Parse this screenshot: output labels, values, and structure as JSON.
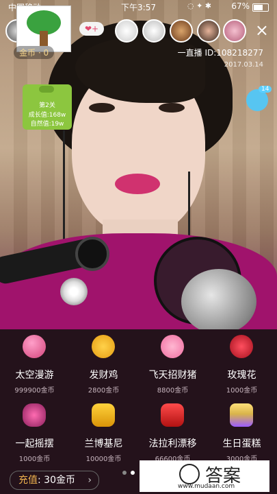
{
  "status_bar": {
    "carrier": "中国移动",
    "time": "下午3:57",
    "battery": "67%"
  },
  "header": {
    "coin_label": "金币 · 0",
    "follow_label": "❤+",
    "close_icon": "×",
    "live_id": "一直播 ID:108218277",
    "date": "2017.03.14"
  },
  "level_card": {
    "level": "第2关",
    "growth": "成长值:168w",
    "nature": "自然值:19w"
  },
  "water_badge": "14",
  "gifts": [
    {
      "name": "太空漫游",
      "price": "999900金币",
      "icon": "planet-icon"
    },
    {
      "name": "发财鸡",
      "price": "2800金币",
      "icon": "chicken-icon"
    },
    {
      "name": "飞天招财猪",
      "price": "8800金币",
      "icon": "pig-icon"
    },
    {
      "name": "玫瑰花",
      "price": "1000金币",
      "icon": "rose-icon"
    },
    {
      "name": "一起摇摆",
      "price": "1000金币",
      "icon": "dance-icon"
    },
    {
      "name": "兰博基尼",
      "price": "10000金币",
      "icon": "lamborghini-icon"
    },
    {
      "name": "法拉利漂移",
      "price": "66600金币",
      "icon": "ferrari-icon"
    },
    {
      "name": "生日蛋糕",
      "price": "3000金币",
      "icon": "cake-icon"
    }
  ],
  "recharge": {
    "label": "充值",
    "value": ": 30金币",
    "arrow": "›"
  },
  "watermark": {
    "text": "答案",
    "url": "www.mudaan.com"
  },
  "colors": {
    "accent": "#f0b34e",
    "panel": "#24121b"
  }
}
